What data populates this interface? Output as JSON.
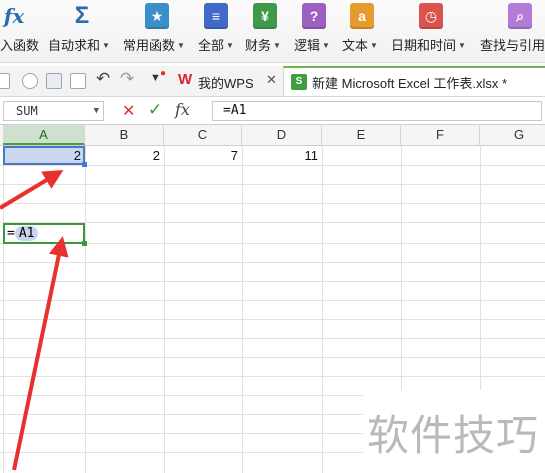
{
  "ribbon": {
    "items": [
      {
        "label": "入函数",
        "icon": "fx-icon",
        "glyph": "fx",
        "color": "#2b6cb0"
      },
      {
        "label": "自动求和",
        "icon": "sigma-icon",
        "glyph": "Σ",
        "color": "#2b6cb0"
      },
      {
        "label": "常用函数",
        "icon": "star-icon",
        "glyph": "★",
        "color": "#3a8fc8"
      },
      {
        "label": "全部",
        "icon": "list-icon",
        "glyph": "≡",
        "color": "#4169c7"
      },
      {
        "label": "财务",
        "icon": "finance-icon",
        "glyph": "¥",
        "color": "#3e9a4a"
      },
      {
        "label": "逻辑",
        "icon": "logic-icon",
        "glyph": "?",
        "color": "#9d5fc0"
      },
      {
        "label": "文本",
        "icon": "text-icon",
        "glyph": "a",
        "color": "#e69b2d"
      },
      {
        "label": "日期和时间",
        "icon": "clock-icon",
        "glyph": "◷",
        "color": "#d9534f"
      },
      {
        "label": "查找与引用",
        "icon": "lookup-icon",
        "glyph": "⌕",
        "color": "#b27bd6"
      }
    ]
  },
  "tabs": {
    "wps_label": "我的WPS",
    "file_label": "新建 Microsoft Excel 工作表.xlsx *"
  },
  "formula_bar": {
    "name_box": "SUM",
    "cancel": "✕",
    "confirm": "✓",
    "fx": "fx",
    "value": "=A1"
  },
  "columns": [
    "A",
    "B",
    "C",
    "D",
    "E",
    "F",
    "G"
  ],
  "row1": {
    "A": "2",
    "B": "2",
    "C": "7",
    "D": "11"
  },
  "edit_cell": {
    "eq": "=",
    "ref": "A1"
  },
  "watermark": "软件技巧",
  "colors": {
    "arrow": "#e8312f",
    "selected_ref": "#c9d7ef",
    "active_border": "#3a9a3a"
  }
}
